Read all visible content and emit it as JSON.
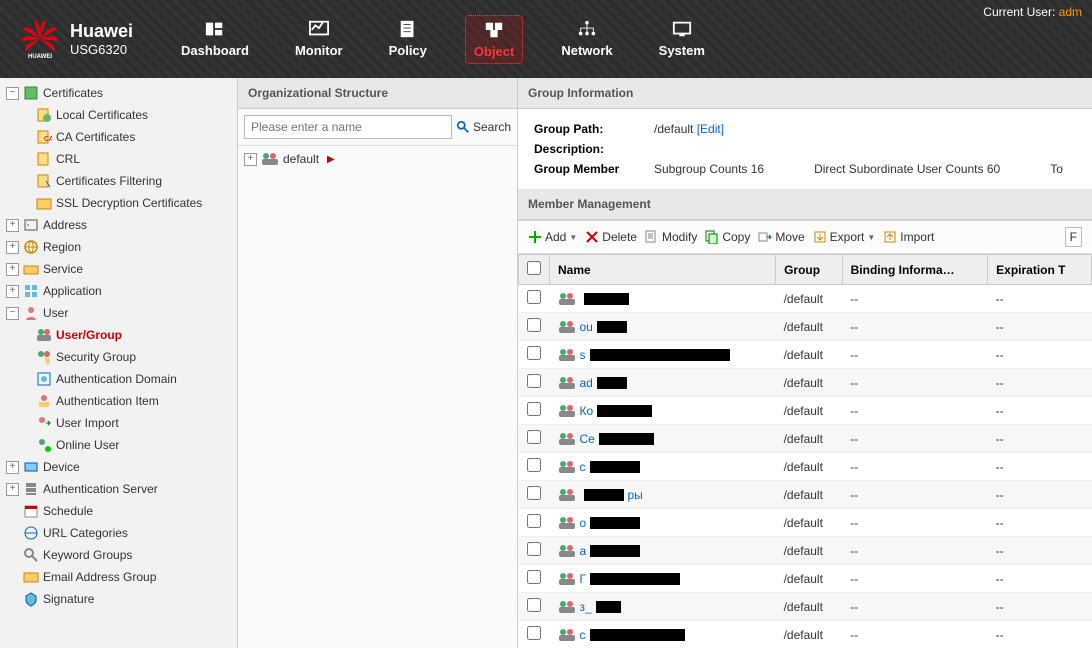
{
  "header": {
    "brand": "Huawei",
    "model": "USG6320",
    "current_user_label": "Current User: ",
    "current_user_name": "adm",
    "nav": [
      {
        "label": "Dashboard"
      },
      {
        "label": "Monitor"
      },
      {
        "label": "Policy"
      },
      {
        "label": "Object",
        "active": true
      },
      {
        "label": "Network"
      },
      {
        "label": "System"
      }
    ]
  },
  "sidebar": {
    "items": [
      {
        "label": "Certificates",
        "expanded": true,
        "icon": "cert",
        "children": [
          {
            "label": "Local Certificates",
            "icon": "cert-local"
          },
          {
            "label": "CA Certificates",
            "icon": "cert-ca"
          },
          {
            "label": "CRL",
            "icon": "cert-crl"
          },
          {
            "label": "Certificates Filtering",
            "icon": "cert-filter"
          },
          {
            "label": "SSL Decryption Certificates",
            "icon": "cert-ssl"
          }
        ]
      },
      {
        "label": "Address",
        "expanded": false,
        "icon": "address"
      },
      {
        "label": "Region",
        "expanded": false,
        "icon": "region"
      },
      {
        "label": "Service",
        "expanded": false,
        "icon": "service"
      },
      {
        "label": "Application",
        "expanded": false,
        "icon": "app"
      },
      {
        "label": "User",
        "expanded": true,
        "icon": "user",
        "children": [
          {
            "label": "User/Group",
            "icon": "user-group",
            "active": true
          },
          {
            "label": "Security Group",
            "icon": "sec-group"
          },
          {
            "label": "Authentication Domain",
            "icon": "auth-domain"
          },
          {
            "label": "Authentication Item",
            "icon": "auth-item"
          },
          {
            "label": "User Import",
            "icon": "user-import"
          },
          {
            "label": "Online User",
            "icon": "online-user"
          }
        ]
      },
      {
        "label": "Device",
        "expanded": false,
        "icon": "device"
      },
      {
        "label": "Authentication Server",
        "expanded": false,
        "icon": "auth-server"
      },
      {
        "label": "Schedule",
        "icon": "schedule",
        "leaf": true
      },
      {
        "label": "URL Categories",
        "icon": "url-cat",
        "leaf": true
      },
      {
        "label": "Keyword Groups",
        "icon": "keyword",
        "leaf": true
      },
      {
        "label": "Email Address Group",
        "icon": "email",
        "leaf": true
      },
      {
        "label": "Signature",
        "icon": "signature",
        "leaf": true
      }
    ]
  },
  "org": {
    "title": "Organizational Structure",
    "search_placeholder": "Please enter a name",
    "search_btn": "Search",
    "root": "default"
  },
  "group_info": {
    "title": "Group Information",
    "path_label": "Group Path:",
    "path_value": "/default",
    "edit": "[Edit]",
    "desc_label": "Description:",
    "member_label": "Group Member",
    "subgroup_text": "Subgroup Counts 16",
    "direct_text": "Direct Subordinate User Counts 60",
    "total_text": "To"
  },
  "member_mgmt": {
    "title": "Member Management",
    "toolbar": {
      "add": "Add",
      "delete": "Delete",
      "modify": "Modify",
      "copy": "Copy",
      "move": "Move",
      "export": "Export",
      "import": "Import"
    },
    "columns": {
      "name": "Name",
      "group": "Group",
      "binding": "Binding Informa…",
      "expiration": "Expiration T"
    },
    "rows": [
      {
        "name_prefix": "",
        "redact_w": 45,
        "group": "/default",
        "binding": "--",
        "exp": "--"
      },
      {
        "name_prefix": "ou",
        "redact_w": 30,
        "group": "/default",
        "binding": "--",
        "exp": "--"
      },
      {
        "name_prefix": "s",
        "redact_w": 140,
        "group": "/default",
        "binding": "--",
        "exp": "--"
      },
      {
        "name_prefix": "ad",
        "redact_w": 30,
        "group": "/default",
        "binding": "--",
        "exp": "--"
      },
      {
        "name_prefix": "Ко",
        "redact_w": 55,
        "group": "/default",
        "binding": "--",
        "exp": "--"
      },
      {
        "name_prefix": "Се",
        "redact_w": 55,
        "group": "/default",
        "binding": "--",
        "exp": "--"
      },
      {
        "name_prefix": "с",
        "redact_w": 50,
        "group": "/default",
        "binding": "--",
        "exp": "--"
      },
      {
        "name_prefix": "",
        "redact_w": 40,
        "suffix": "ры",
        "group": "/default",
        "binding": "--",
        "exp": "--"
      },
      {
        "name_prefix": "о",
        "redact_w": 50,
        "group": "/default",
        "binding": "--",
        "exp": "--"
      },
      {
        "name_prefix": "а",
        "redact_w": 50,
        "group": "/default",
        "binding": "--",
        "exp": "--"
      },
      {
        "name_prefix": "Г",
        "redact_w": 90,
        "group": "/default",
        "binding": "--",
        "exp": "--"
      },
      {
        "name_prefix": "з_",
        "redact_w": 25,
        "group": "/default",
        "binding": "--",
        "exp": "--"
      },
      {
        "name_prefix": "с",
        "redact_w": 95,
        "group": "/default",
        "binding": "--",
        "exp": "--"
      }
    ]
  }
}
